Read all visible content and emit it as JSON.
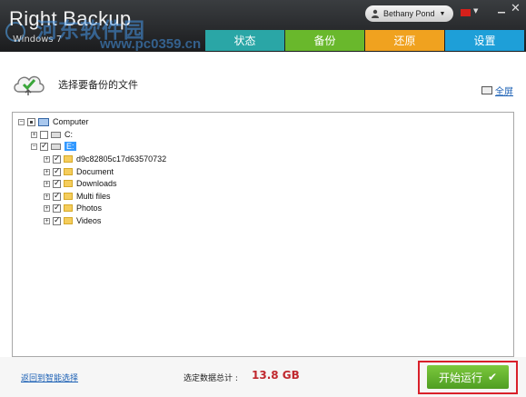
{
  "app": {
    "title": "Right Backup",
    "subtitle": "Windows 7",
    "watermark": "河东软件园",
    "watermark_url": "www.pc0359.cn"
  },
  "user": {
    "name": "Bethany Pond"
  },
  "tabs": [
    {
      "label": "状态",
      "color": "#2aa6a6"
    },
    {
      "label": "备份",
      "color": "#69b82c"
    },
    {
      "label": "还原",
      "color": "#f0a21f"
    },
    {
      "label": "设置",
      "color": "#1e9fd8"
    }
  ],
  "header": {
    "title": "选择要备份的文件",
    "fullscreen_label": "全屏",
    "icon": "cloud-upload-icon"
  },
  "tree": {
    "root": "Computer",
    "drives": [
      {
        "label": "C:",
        "checked": false
      },
      {
        "label": "E:",
        "checked": true,
        "selected": true
      }
    ],
    "folders": [
      {
        "label": "d9c82805c17d63570732",
        "checked": true
      },
      {
        "label": "Document",
        "checked": true
      },
      {
        "label": "Downloads",
        "checked": true
      },
      {
        "label": "Multi files",
        "checked": true
      },
      {
        "label": "Photos",
        "checked": true
      },
      {
        "label": "Videos",
        "checked": true
      }
    ]
  },
  "footer": {
    "back_link": "返回到智能选择",
    "total_label": "选定数据总计 :",
    "total_value": "13.8 GB",
    "start_button": "开始运行"
  },
  "colors": {
    "accent_green": "#69b82c",
    "total_red": "#c0282e",
    "highlight_outline": "#d9202a"
  }
}
